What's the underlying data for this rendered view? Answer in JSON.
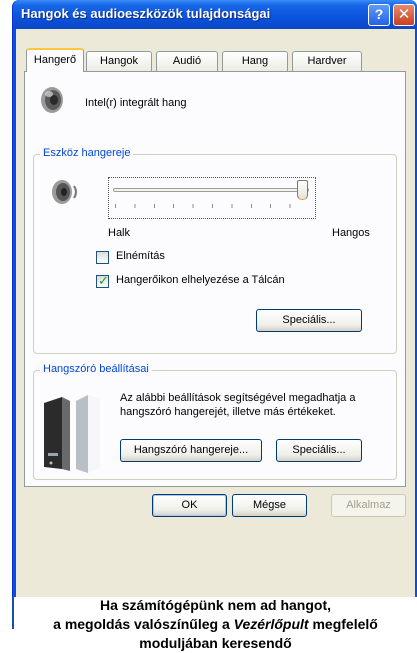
{
  "window": {
    "title": "Hangok és audioeszközök tulajdonságai",
    "help_button": "?",
    "close_button": "✕"
  },
  "tabs": [
    {
      "label": "Hangerő",
      "active": true
    },
    {
      "label": "Hangok",
      "active": false
    },
    {
      "label": "Audió",
      "active": false
    },
    {
      "label": "Hang",
      "active": false
    },
    {
      "label": "Hardver",
      "active": false
    }
  ],
  "device": {
    "name": "Intel(r) integrált hang",
    "icon": "speaker-icon"
  },
  "volume_group": {
    "title": "Eszköz hangereje",
    "slider_min_label": "Halk",
    "slider_max_label": "Hangos",
    "slider_level": 1.0,
    "mute_label": "Elnémítás",
    "mute_checked": false,
    "tray_icon_label": "Hangerőikon elhelyezése a Tálcán",
    "tray_icon_checked": true,
    "advanced_button": "Speciális..."
  },
  "speaker_group": {
    "title": "Hangszóró beállításai",
    "description": "Az alábbi beállítások segítségével megadhatja a hangszóró hangerejét, illetve más értékeket.",
    "volume_button": "Hangszóró hangereje...",
    "advanced_button": "Speciális..."
  },
  "buttons": {
    "ok": "OK",
    "cancel": "Mégse",
    "apply": "Alkalmaz"
  },
  "caption": {
    "line1": "Ha számítógépünk nem ad hangot,",
    "line2_prefix": "a megoldás valószínűleg a ",
    "line2_emph": "Vezérlőpult",
    "line2_suffix": " megfelelő",
    "line3": "moduljában keresendő"
  },
  "colors": {
    "titlebar": "#0b55dd",
    "dialog_bg": "#ece9d8",
    "group_title": "#0046d5",
    "tab_highlight": "#ffc83c"
  }
}
